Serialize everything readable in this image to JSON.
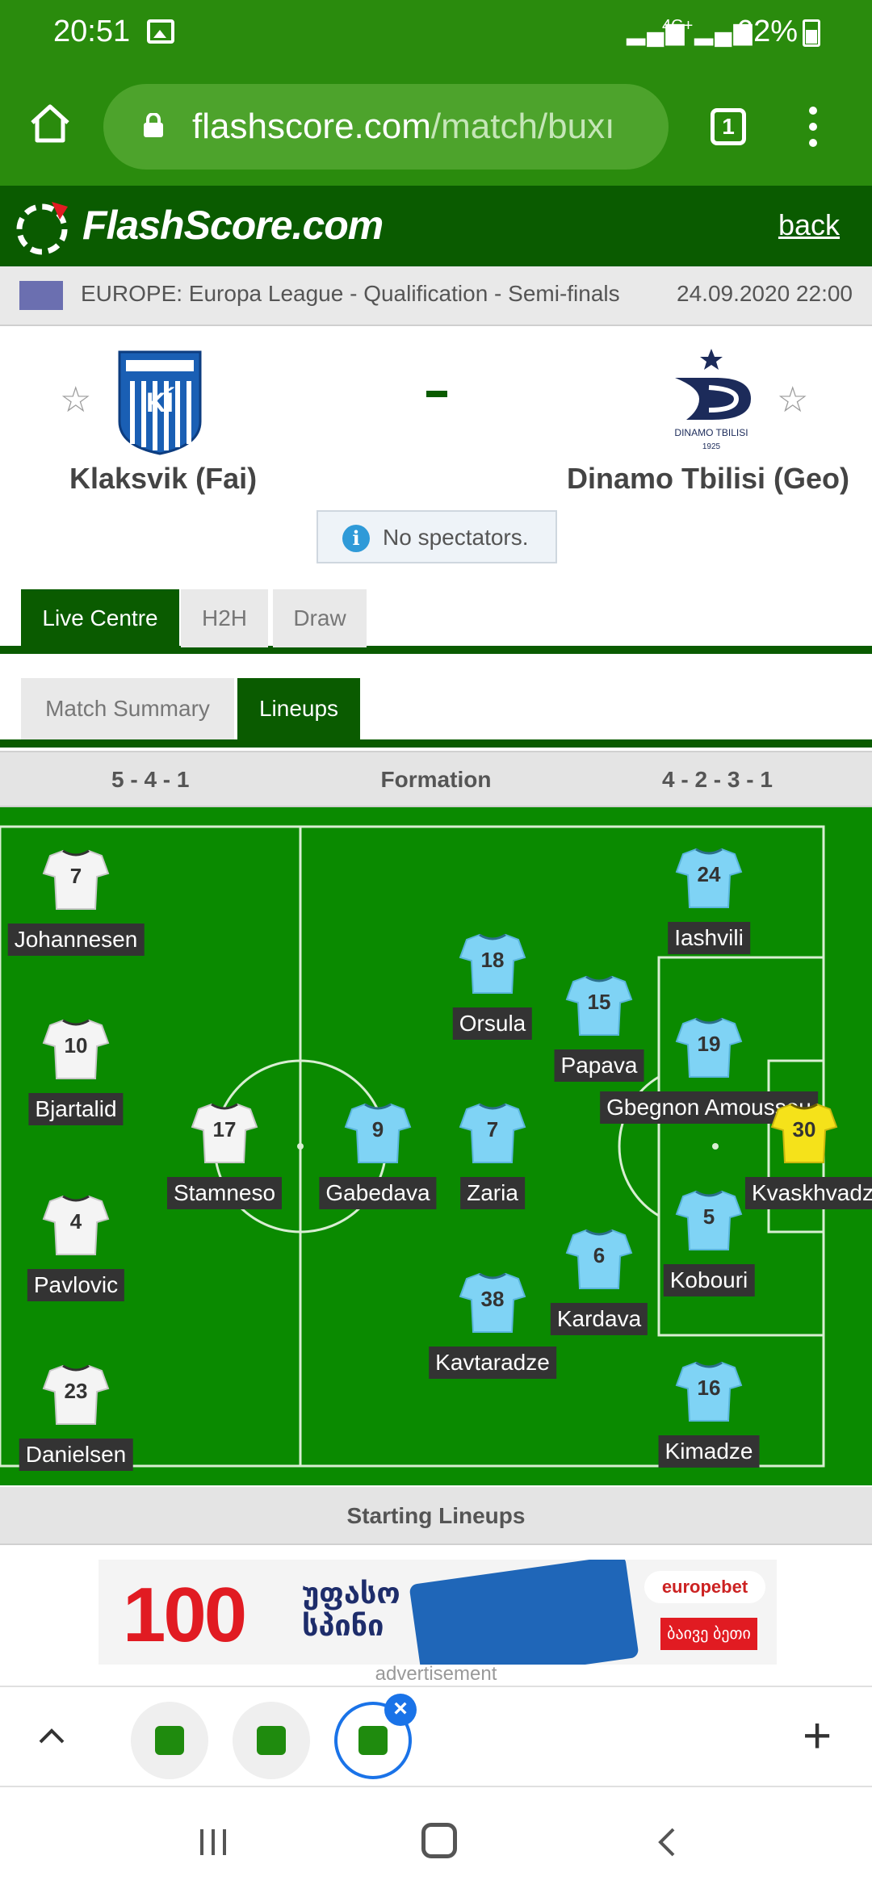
{
  "status": {
    "time": "20:51",
    "network": "4G+",
    "battery": "62%"
  },
  "browser": {
    "url_main": "flashscore.com",
    "url_path": "/match/buxı",
    "tab_count": "1"
  },
  "site": {
    "name": "FlashScore.com",
    "back_label": "back"
  },
  "competition": {
    "name": "EUROPE: Europa League - Qualification - Semi-finals",
    "date": "24.09.2020 22:00"
  },
  "match": {
    "home_team": "Klaksvik (Fai)",
    "away_team": "Dinamo Tbilisi (Geo)",
    "score_separator": "-",
    "notice": "No spectators.",
    "away_crest_text": "DINAMO TBILISI",
    "away_crest_year": "1925"
  },
  "tabs_main": [
    "Live Centre",
    "H2H",
    "Draw"
  ],
  "tabs_sub": [
    "Match Summary",
    "Lineups"
  ],
  "formation": {
    "home": "5 - 4 - 1",
    "label": "Formation",
    "away": "4 - 2 - 3 - 1"
  },
  "players_home": [
    {
      "num": "7",
      "name": "Johannesen"
    },
    {
      "num": "10",
      "name": "Bjartalid"
    },
    {
      "num": "4",
      "name": "Pavlovic"
    },
    {
      "num": "23",
      "name": "Danielsen"
    },
    {
      "num": "17",
      "name": "Stamneso"
    }
  ],
  "players_away": [
    {
      "num": "9",
      "name": "Gabedava"
    },
    {
      "num": "18",
      "name": "Orsula"
    },
    {
      "num": "7",
      "name": "Zaria"
    },
    {
      "num": "38",
      "name": "Kavtaradze"
    },
    {
      "num": "15",
      "name": "Papava"
    },
    {
      "num": "6",
      "name": "Kardava"
    },
    {
      "num": "24",
      "name": "Iashvili"
    },
    {
      "num": "19",
      "name": "Gbegnon Amoussou"
    },
    {
      "num": "5",
      "name": "Kobouri"
    },
    {
      "num": "16",
      "name": "Kimadze"
    },
    {
      "num": "30",
      "name": "Kvaskhvadze"
    }
  ],
  "section_label": "Starting Lineups",
  "ad": {
    "big": "100",
    "line1": "უფასო",
    "line2": "სპინი",
    "brand": "europebet",
    "cta": "ბაივე ბეთი",
    "label": "advertisement"
  },
  "colors": {
    "brand_green": "#0a5b00",
    "pitch": "#0a8a00",
    "home_shirt": "#ffffff",
    "away_shirt": "#7fd3f5",
    "keeper_shirt": "#f5e21a"
  }
}
